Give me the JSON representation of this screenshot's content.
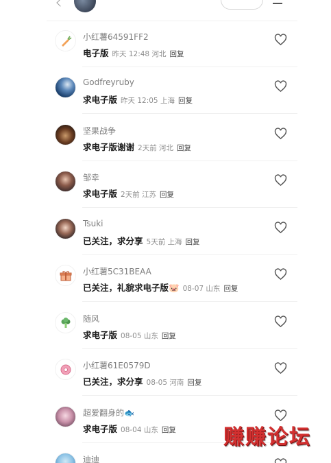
{
  "comments": [
    {
      "username": "小红薯64591FF2",
      "comment": "电子版",
      "meta": "昨天 12:48 河北",
      "reply": "回复",
      "avatar_icon": "carrot-icon"
    },
    {
      "username": "Godfreyruby",
      "comment": "求电子版",
      "meta": "昨天 12:05 上海",
      "reply": "回复",
      "avatar_icon": "ocean-photo-avatar"
    },
    {
      "username": "坚果战争",
      "comment": "求电子版谢谢",
      "meta": "2天前 河北",
      "reply": "回复",
      "avatar_icon": "cat-photo-avatar"
    },
    {
      "username": "邹幸",
      "comment": "求电子版",
      "meta": "2天前 江苏",
      "reply": "回复",
      "avatar_icon": "person-photo-avatar"
    },
    {
      "username": "Tsuki",
      "comment": "已关注，求分享",
      "meta": "5天前 上海",
      "reply": "回复",
      "avatar_icon": "person-photo-avatar"
    },
    {
      "username": "小红薯5C31BEAA",
      "comment": "已关注，礼貌求电子版🐷",
      "meta": "08-07 山东",
      "reply": "回复",
      "avatar_icon": "gift-icon"
    },
    {
      "username": "随风",
      "comment": "求电子版",
      "meta": "08-05 山东",
      "reply": "回复",
      "avatar_icon": "broccoli-icon"
    },
    {
      "username": "小红薯61E0579D",
      "comment": "已关注，求分享",
      "meta": "08-05 河南",
      "reply": "回复",
      "avatar_icon": "donut-icon"
    },
    {
      "username": "超爱翻身的🐟",
      "comment": "求电子版",
      "meta": "08-04 山东",
      "reply": "回复",
      "avatar_icon": "person-photo-avatar"
    },
    {
      "username": "迪迪",
      "comment": "",
      "meta": "",
      "reply": "",
      "avatar_icon": "cartoon-avatar"
    }
  ],
  "watermark": "赚赚论坛",
  "colors": {
    "username": "#7d7d7d",
    "meta": "#8d8d8d",
    "watermark": "#d23030"
  }
}
